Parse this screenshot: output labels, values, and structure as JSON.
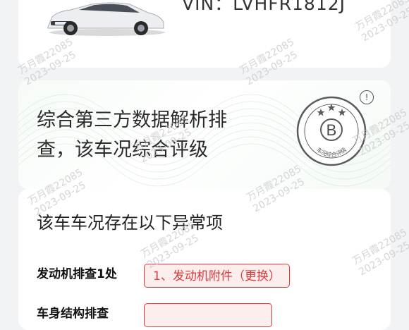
{
  "vin": {
    "text": "VIN：LVHFR1812J"
  },
  "rating": {
    "title_line1": "综合第三方数据解析排",
    "title_line2": "查，该车况综合评级",
    "grade": "B",
    "badge_caption": "车况综合评级",
    "info": "!"
  },
  "anomalies": {
    "section_title": "该车车况存在以下异常项",
    "rows": [
      {
        "label": "发动机排查1处",
        "tag": "1、发动机附件（更换）"
      },
      {
        "label": "车身结构排查",
        "tag": ""
      }
    ]
  },
  "watermark": {
    "line1": "万月霞22085",
    "line2": "2023-09-25"
  },
  "colors": {
    "accent": "#d93a3a",
    "tag_bg": "#fdeeee",
    "badge_gray": "#5a5a5a"
  }
}
